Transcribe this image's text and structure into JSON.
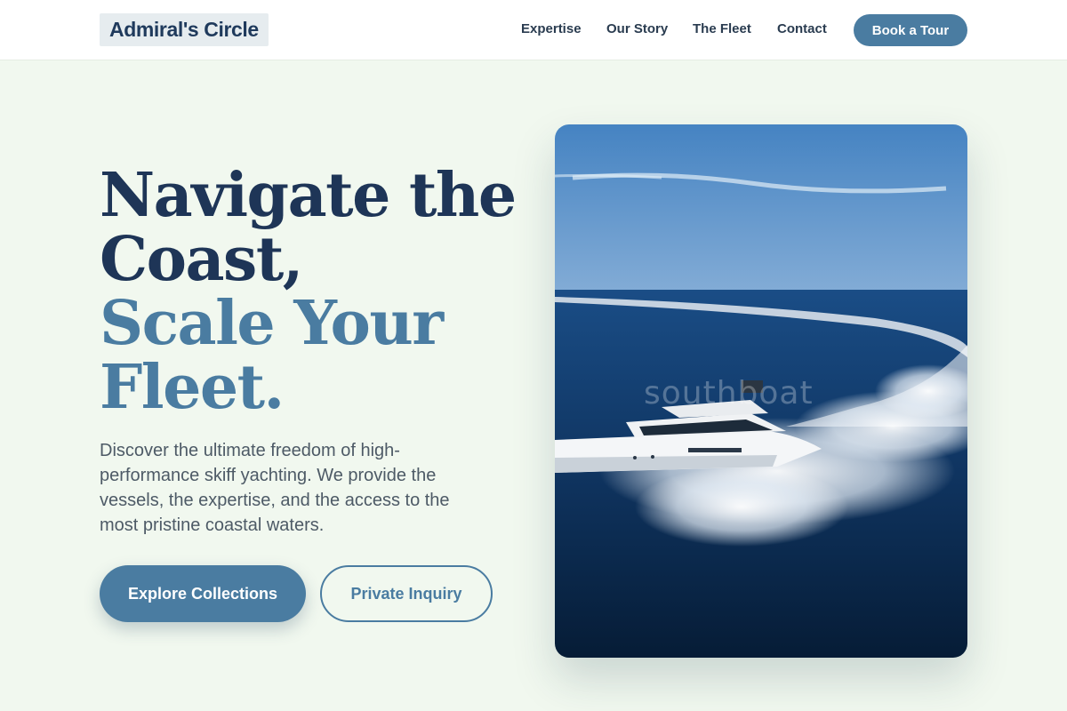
{
  "header": {
    "logo": "Admiral's Circle",
    "nav": [
      "Expertise",
      "Our Story",
      "The Fleet",
      "Contact"
    ],
    "cta": "Book a Tour"
  },
  "hero": {
    "title_line1": "Navigate the",
    "title_line2": "Coast,",
    "title_line3": "Scale Your",
    "title_line4": "Fleet.",
    "subtitle": "Discover the ultimate freedom of high-performance skiff yachting. We provide the vessels, the expertise, and the access to the most pristine coastal waters.",
    "primary_button": "Explore Collections",
    "secondary_button": "Private Inquiry"
  },
  "image": {
    "watermark": "southboat"
  },
  "colors": {
    "accent": "#4a7ca1",
    "navy": "#1e3557",
    "background": "#f1f8ef"
  }
}
